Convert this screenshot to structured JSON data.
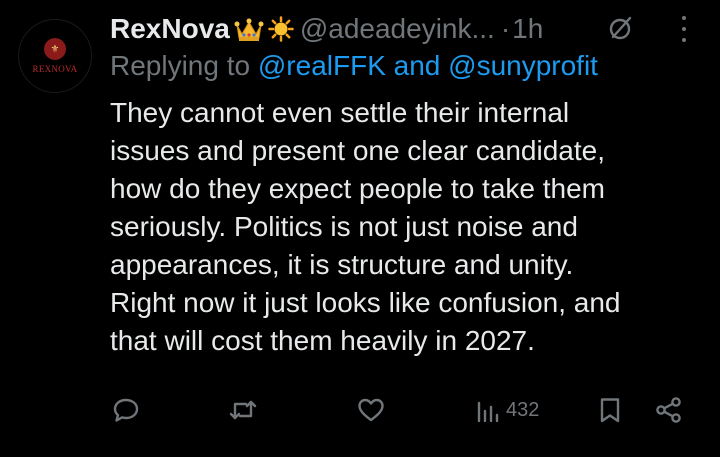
{
  "post": {
    "author_name": "RexNova",
    "author_emojis": [
      "crown-emoji",
      "sun-emoji"
    ],
    "handle": "@adeadeyink...",
    "separator": "·",
    "time": "1h",
    "avatar_text": "REXNOVA",
    "reply_prefix": "Replying to",
    "reply_mentions": "@realFFK and @sunyprofit",
    "body_lines": [
      "They cannot even settle their internal",
      "issues and present one clear candidate,",
      "how do they expect people to take them",
      "seriously. Politics is not just noise and",
      "appearances, it is structure and unity.",
      "Right now it just looks like confusion, and",
      "that will cost them heavily in 2027."
    ]
  },
  "actions": {
    "views": "432",
    "icons": [
      "reply-icon",
      "repost-icon",
      "like-icon",
      "views-icon",
      "bookmark-icon",
      "share-icon"
    ]
  },
  "colors": {
    "background": "#000000",
    "text": "#e7e9ea",
    "muted": "#71767b",
    "link": "#1d9bf0",
    "avatar_brand": "#b8292a"
  }
}
